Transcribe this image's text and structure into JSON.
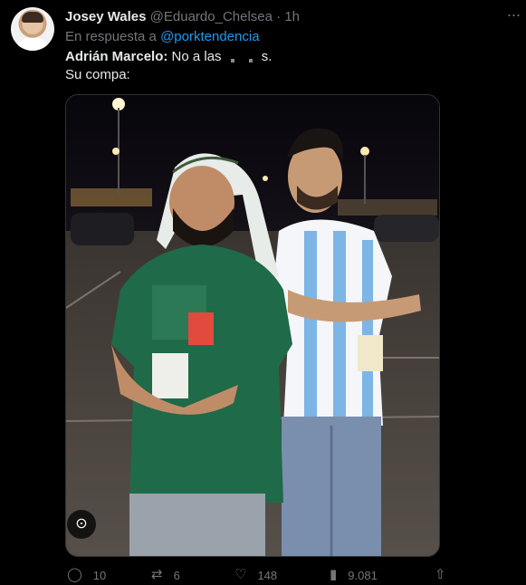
{
  "tweet": {
    "author_name": "Josey Wales",
    "handle": "@Eduardo_Chelsea",
    "separator": "·",
    "time": "1h",
    "reply_prefix": "En respuesta a",
    "reply_mention": "@porktendencia",
    "line1_speaker": "Adrián Marcelo:",
    "line1_text": " No a las",
    "line1_end": "s.",
    "line2_text": "Su compa:"
  },
  "stats": {
    "replies": "10",
    "retweets": "6",
    "likes": "148",
    "views": "9.081"
  },
  "icons": {
    "more": "more-icon",
    "reply": "reply-icon",
    "retweet": "retweet-icon",
    "like": "heart-icon",
    "views": "views-icon",
    "share": "share-icon",
    "media_badge": "scan-icon"
  },
  "colors": {
    "background": "#000000",
    "text": "#e7e9ea",
    "muted": "#71767b",
    "link": "#1d9bf0"
  }
}
